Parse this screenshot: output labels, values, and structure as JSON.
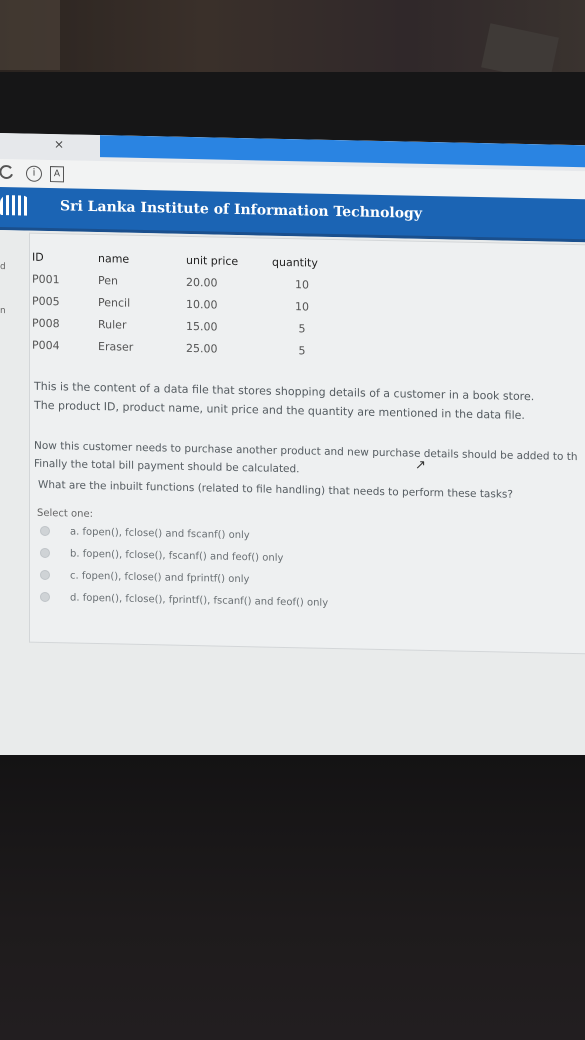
{
  "browser": {
    "tab_close": "×",
    "reload_icon": "reload-icon",
    "info_icon": "info-icon",
    "info_glyph": "i",
    "bookmark_icon": "bookmark-icon",
    "bookmark_glyph": "A"
  },
  "site": {
    "title": "Sri Lanka Institute of Information Technology",
    "header_color": "#1b64b4"
  },
  "question": {
    "table": {
      "headers": [
        "ID",
        "name",
        "unit price",
        "quantity"
      ],
      "rows": [
        [
          "P001",
          "Pen",
          "20.00",
          "10"
        ],
        [
          "P005",
          "Pencil",
          "10.00",
          "10"
        ],
        [
          "P008",
          "Ruler",
          "15.00",
          "5"
        ],
        [
          "P004",
          "Eraser",
          "25.00",
          "5"
        ]
      ]
    },
    "text": [
      "This is the content of a data file that stores shopping details of a customer in a book store.",
      "The product ID, product name, unit price and the quantity are mentioned in the data file.",
      "Now this customer needs to purchase another product and new purchase details should be added to th",
      "Finally the total bill payment should be calculated.",
      "What are the inbuilt functions (related to file handling) that needs to perform these tasks?"
    ],
    "select_label": "Select one:",
    "options": [
      "a. fopen(), fclose() and fscanf() only",
      "b. fopen(), fclose(), fscanf() and feof() only",
      "c. fopen(), fclose() and fprintf() only",
      "d. fopen(), fclose(), fprintf(), fscanf() and feof() only"
    ]
  }
}
